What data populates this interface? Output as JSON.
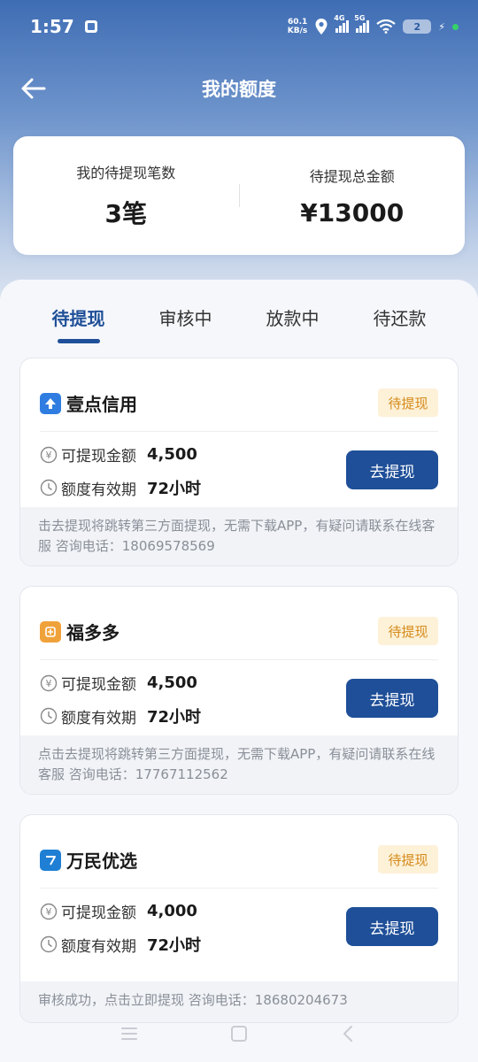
{
  "status_bar": {
    "time": "1:57",
    "net_speed_value": "60.1",
    "net_speed_unit": "KB/s",
    "signal_1": "4G",
    "signal_2": "5G",
    "battery": "2"
  },
  "header": {
    "title": "我的额度"
  },
  "summary": {
    "count_label": "我的待提现笔数",
    "count_value": "3笔",
    "total_label": "待提现总金额",
    "total_value": "¥13000"
  },
  "tabs": [
    {
      "label": "待提现",
      "active": true
    },
    {
      "label": "审核中",
      "active": false
    },
    {
      "label": "放款中",
      "active": false
    },
    {
      "label": "待还款",
      "active": false
    }
  ],
  "cards": [
    {
      "name": "壹点信用",
      "icon_color": "#2f7de0",
      "status": "待提现",
      "amount_label": "可提现金额",
      "amount": "4,500",
      "validity_label": "额度有效期",
      "validity": "72小时",
      "button": "去提现",
      "note": "击去提现将跳转第三方面提现，无需下载APP，有疑问请联系在线客服 咨询电话：18069578569"
    },
    {
      "name": "福多多",
      "icon_color": "#f0a23a",
      "status": "待提现",
      "amount_label": "可提现金额",
      "amount": "4,500",
      "validity_label": "额度有效期",
      "validity": "72小时",
      "button": "去提现",
      "note": "点击去提现将跳转第三方面提现，无需下载APP，有疑问请联系在线客服 咨询电话：17767112562"
    },
    {
      "name": "万民优选",
      "icon_color": "#1f7fd4",
      "status": "待提现",
      "amount_label": "可提现金额",
      "amount": "4,000",
      "validity_label": "额度有效期",
      "validity": "72小时",
      "button": "去提现",
      "note": "审核成功，点击立即提现 咨询电话：18680204673"
    }
  ]
}
